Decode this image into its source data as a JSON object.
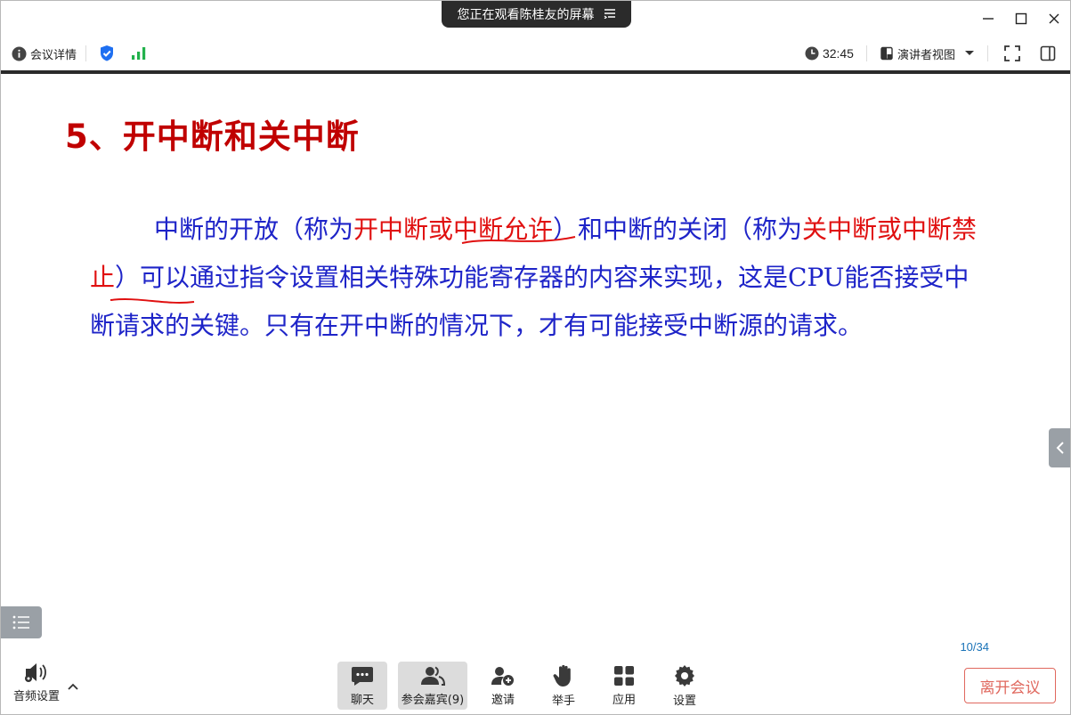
{
  "share_banner": {
    "text": "您正在观看陈桂友的屏幕",
    "icon": "menu-icon"
  },
  "toolbar": {
    "meeting_info_label": "会议详情",
    "timer": "32:45",
    "view_label": "演讲者视图",
    "security_color": "#1e6ff1",
    "signal_color": "#22b14c"
  },
  "slide": {
    "title": "5、开中断和关中断",
    "body": [
      {
        "text": "中断的开放（称为",
        "red": false
      },
      {
        "text": "开中断或中断允许",
        "red": true
      },
      {
        "text": "）和中断的关闭（称为",
        "red": false
      },
      {
        "text": "关中断或中断禁止",
        "red": true
      },
      {
        "text": "）可以通过指令设置相关特殊功能寄存器的内容来实现，这是CPU能否接受中断请求的关键。只有在开中断的情况下，才有可能接受中断源的请求。",
        "red": false
      }
    ],
    "page_indicator": "10/34"
  },
  "bottom": {
    "audio_label": "音频设置",
    "tools": [
      {
        "label": "聊天",
        "icon": "chat-icon",
        "active": true
      },
      {
        "label": "参会嘉宾(9)",
        "icon": "participants-icon",
        "active": true
      },
      {
        "label": "邀请",
        "icon": "invite-icon",
        "active": false
      },
      {
        "label": "举手",
        "icon": "raise-hand-icon",
        "active": false
      },
      {
        "label": "应用",
        "icon": "apps-icon",
        "active": false
      },
      {
        "label": "设置",
        "icon": "settings-icon",
        "active": false
      }
    ],
    "leave_label": "离开会议",
    "leave_color": "#e0685e"
  }
}
